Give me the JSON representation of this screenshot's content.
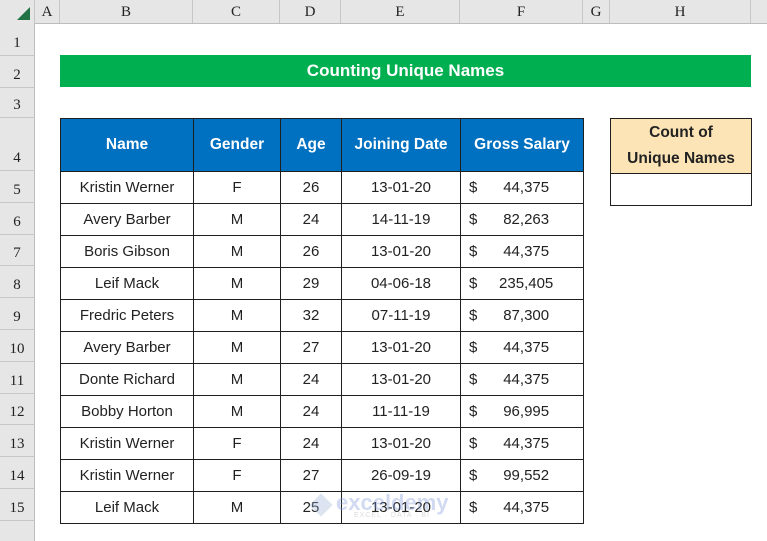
{
  "spreadsheet": {
    "columns": [
      "A",
      "B",
      "C",
      "D",
      "E",
      "F",
      "G",
      "H"
    ],
    "rows": [
      "1",
      "2",
      "3",
      "4",
      "5",
      "6",
      "7",
      "8",
      "9",
      "10",
      "11",
      "12",
      "13",
      "14",
      "15"
    ]
  },
  "title": "Counting Unique Names",
  "table": {
    "headers": [
      "Name",
      "Gender",
      "Age",
      "Joining Date",
      "Gross Salary"
    ],
    "currency_symbol": "$",
    "rows": [
      {
        "name": "Kristin Werner",
        "gender": "F",
        "age": "26",
        "date": "13-01-20",
        "salary": "44,375"
      },
      {
        "name": "Avery Barber",
        "gender": "M",
        "age": "24",
        "date": "14-11-19",
        "salary": "82,263"
      },
      {
        "name": "Boris Gibson",
        "gender": "M",
        "age": "26",
        "date": "13-01-20",
        "salary": "44,375"
      },
      {
        "name": "Leif Mack",
        "gender": "M",
        "age": "29",
        "date": "04-06-18",
        "salary": "235,405"
      },
      {
        "name": "Fredric Peters",
        "gender": "M",
        "age": "32",
        "date": "07-11-19",
        "salary": "87,300"
      },
      {
        "name": "Avery Barber",
        "gender": "M",
        "age": "27",
        "date": "13-01-20",
        "salary": "44,375"
      },
      {
        "name": "Donte Richard",
        "gender": "M",
        "age": "24",
        "date": "13-01-20",
        "salary": "44,375"
      },
      {
        "name": "Bobby Horton",
        "gender": "M",
        "age": "24",
        "date": "11-11-19",
        "salary": "96,995"
      },
      {
        "name": "Kristin Werner",
        "gender": "F",
        "age": "24",
        "date": "13-01-20",
        "salary": "44,375"
      },
      {
        "name": "Kristin Werner",
        "gender": "F",
        "age": "27",
        "date": "26-09-19",
        "salary": "99,552"
      },
      {
        "name": "Leif Mack",
        "gender": "M",
        "age": "25",
        "date": "13-01-20",
        "salary": "44,375"
      }
    ]
  },
  "side": {
    "header_line1": "Count of",
    "header_line2": "Unique Names",
    "value": ""
  },
  "watermark": {
    "text": "exceldemy",
    "tagline": "EXCEL · DATA · BI"
  }
}
